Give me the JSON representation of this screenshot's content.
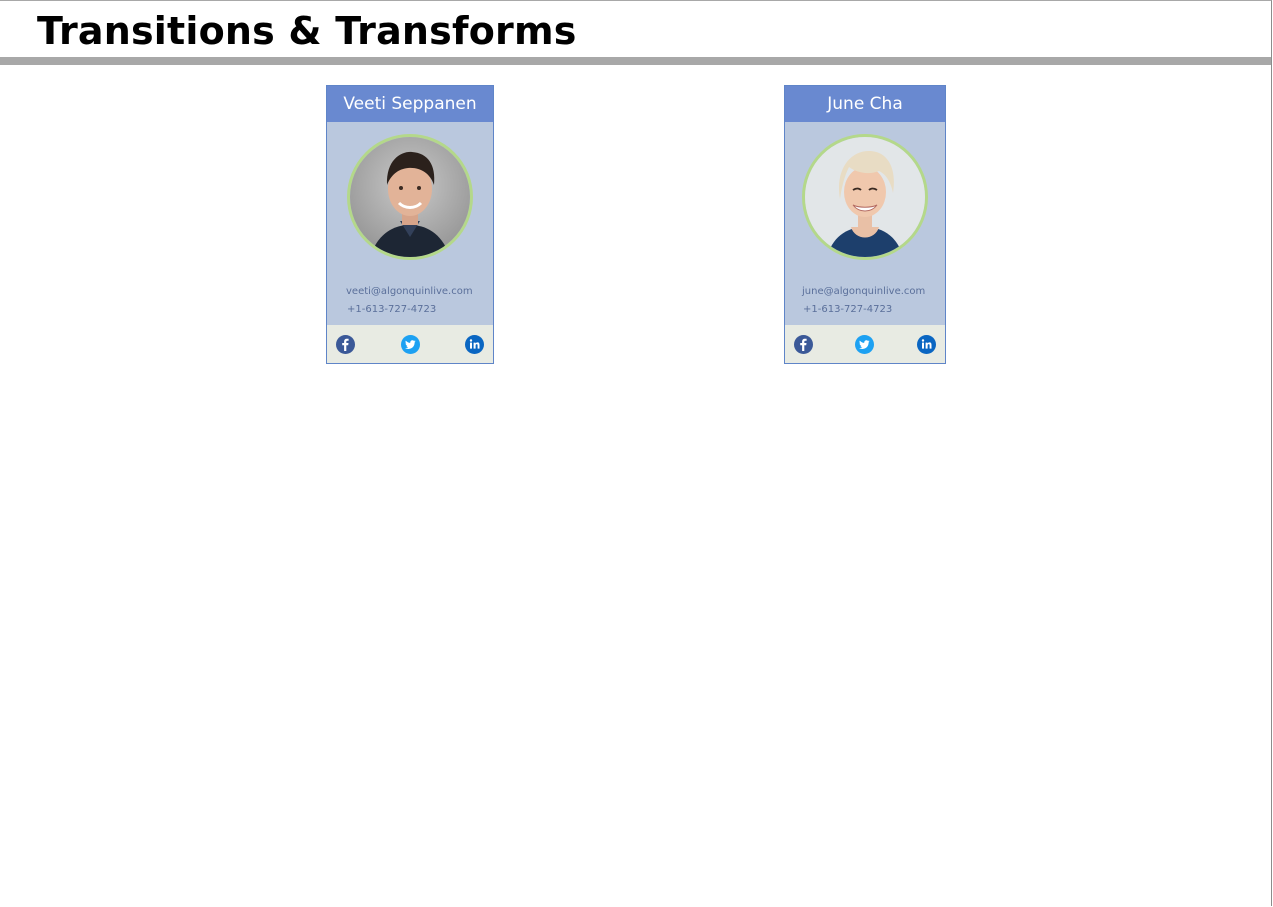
{
  "page": {
    "title": "Transitions & Transforms"
  },
  "cards": [
    {
      "name": "Veeti Seppanen",
      "email": "veeti@algonquinlive.com",
      "phone": "+1-613-727-4723"
    },
    {
      "name": "June Cha",
      "email": "june@algonquinlive.com",
      "phone": "+1-613-727-4723"
    }
  ],
  "social_icons": [
    "facebook-icon",
    "twitter-icon",
    "linkedin-icon"
  ],
  "colors": {
    "card_header": "#6989d0",
    "card_body": "#bac8de",
    "card_footer": "#e8ebe3",
    "avatar_ring": "#b4d88a",
    "facebook": "#3b5998",
    "twitter": "#1da1f2",
    "linkedin": "#0a66c2"
  }
}
